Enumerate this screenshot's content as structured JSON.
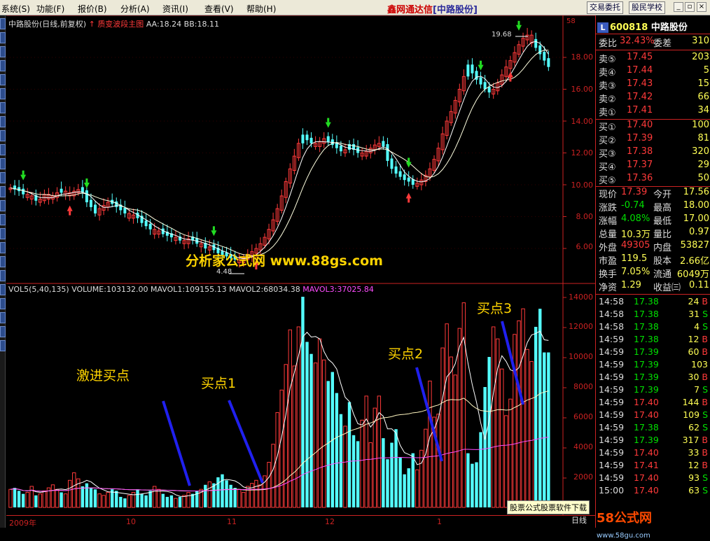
{
  "menu": {
    "items": [
      "系统(S)",
      "功能(F)",
      "报价(B)",
      "分析(A)",
      "资讯(I)",
      "查看(V)",
      "帮助(H)"
    ],
    "brand_main": "鑫网通达信",
    "brand_sub": "[中路股份]",
    "buttons": [
      "交易委托",
      "股民学校"
    ]
  },
  "chart": {
    "header_main": "中路股份(日线,前复权)",
    "header_indicator": "质变波段主图",
    "header_aa": "AA:18.24",
    "header_bb": "BB:18.11",
    "vol_header": "VOL5(5,40,135)",
    "volume": "VOLUME:103132.00",
    "mavol1": "MAVOL1:109155.13",
    "mavol2": "MAVOL2:68034.38",
    "mavol3": "MAVOL3:37025.84",
    "high_label": "19.68",
    "low_label": "4.48",
    "watermark": "分析家公式网 www.88gs.com",
    "annotations": [
      "激进买点",
      "买点1",
      "买点2",
      "买点3"
    ],
    "corner_label": "58",
    "price_axis": [
      "18.00",
      "16.00",
      "14.00",
      "12.00",
      "10.00",
      "8.00",
      "6.00"
    ],
    "vol_axis": [
      "14000",
      "12000",
      "10000",
      "8000",
      "6000",
      "4000",
      "2000"
    ],
    "date_labels": [
      "2009年",
      "10",
      "11",
      "12",
      "1"
    ],
    "day_label": "日线"
  },
  "quote": {
    "code": "600818",
    "name": "中路股份",
    "weibi_label": "委比",
    "weibi_value": "32.43%",
    "weicha_label": "委差",
    "weicha_value": "310",
    "asks": [
      {
        "label": "卖⑤",
        "price": "17.45",
        "vol": "203"
      },
      {
        "label": "卖④",
        "price": "17.44",
        "vol": "5"
      },
      {
        "label": "卖③",
        "price": "17.43",
        "vol": "15"
      },
      {
        "label": "卖②",
        "price": "17.42",
        "vol": "66"
      },
      {
        "label": "卖①",
        "price": "17.41",
        "vol": "34"
      }
    ],
    "bids": [
      {
        "label": "买①",
        "price": "17.40",
        "vol": "100"
      },
      {
        "label": "买②",
        "price": "17.39",
        "vol": "81"
      },
      {
        "label": "买③",
        "price": "17.38",
        "vol": "320"
      },
      {
        "label": "买④",
        "price": "17.37",
        "vol": "29"
      },
      {
        "label": "买⑤",
        "price": "17.36",
        "vol": "50"
      }
    ],
    "stats": [
      {
        "l1": "现价",
        "v1": "17.39",
        "l2": "今开",
        "v2": "17.56"
      },
      {
        "l1": "涨跌",
        "v1": "-0.74",
        "l2": "最高",
        "v2": "18.00"
      },
      {
        "l1": "涨幅",
        "v1": "4.08%",
        "l2": "最低",
        "v2": "17.00"
      },
      {
        "l1": "总量",
        "v1": "10.3万",
        "l2": "量比",
        "v2": "0.97"
      },
      {
        "l1": "外盘",
        "v1": "49305",
        "l2": "内盘",
        "v2": "53827"
      },
      {
        "l1": "市盈",
        "v1": "119.5",
        "l2": "股本",
        "v2": "2.66亿"
      },
      {
        "l1": "换手",
        "v1": "7.05%",
        "l2": "流通",
        "v2": "6049万"
      },
      {
        "l1": "净资",
        "v1": "1.29",
        "l2": "收益㈢",
        "v2": "0.11"
      }
    ],
    "ticks": [
      {
        "time": "14:58",
        "price": "17.38",
        "vol": "24",
        "side": "B"
      },
      {
        "time": "14:58",
        "price": "17.38",
        "vol": "31",
        "side": "S"
      },
      {
        "time": "14:58",
        "price": "17.38",
        "vol": "4",
        "side": "S"
      },
      {
        "time": "14:59",
        "price": "17.38",
        "vol": "12",
        "side": "B"
      },
      {
        "time": "14:59",
        "price": "17.39",
        "vol": "60",
        "side": "B"
      },
      {
        "time": "14:59",
        "price": "17.39",
        "vol": "103",
        "side": ""
      },
      {
        "time": "14:59",
        "price": "17.39",
        "vol": "30",
        "side": "B"
      },
      {
        "time": "14:59",
        "price": "17.39",
        "vol": "7",
        "side": "S"
      },
      {
        "time": "14:59",
        "price": "17.40",
        "vol": "144",
        "side": "B"
      },
      {
        "time": "14:59",
        "price": "17.40",
        "vol": "109",
        "side": "S"
      },
      {
        "time": "14:59",
        "price": "17.38",
        "vol": "62",
        "side": "S"
      },
      {
        "time": "14:59",
        "price": "17.39",
        "vol": "317",
        "side": "B"
      },
      {
        "time": "14:59",
        "price": "17.40",
        "vol": "33",
        "side": "B"
      },
      {
        "time": "14:59",
        "price": "17.41",
        "vol": "12",
        "side": "B"
      },
      {
        "time": "14:59",
        "price": "17.40",
        "vol": "93",
        "side": "S"
      },
      {
        "time": "15:00",
        "price": "17.40",
        "vol": "63",
        "side": "S"
      }
    ]
  },
  "footer": {
    "ad": "股票公式股票软件下载",
    "logo_main": "58公式网",
    "logo_url": "www.58gu.com"
  },
  "colors": {
    "up": "#ff3a3a",
    "down_candle": "#54ffff",
    "grid": "#cc2222",
    "arrow_line": "#2020ee"
  }
}
